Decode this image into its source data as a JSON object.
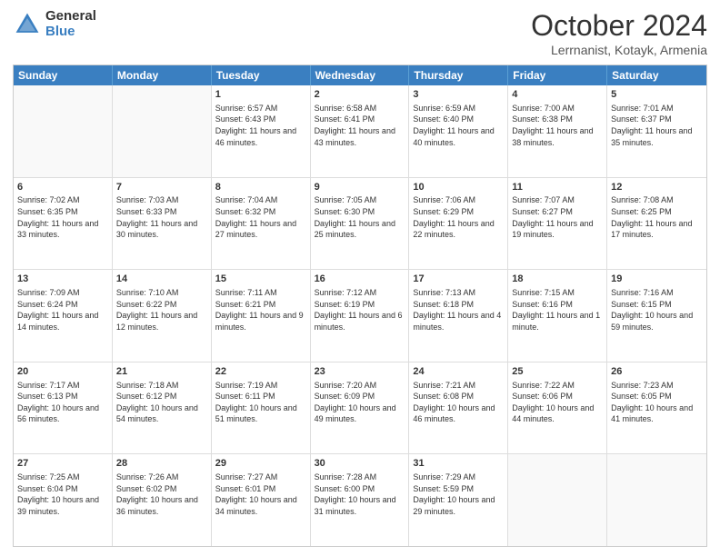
{
  "logo": {
    "general": "General",
    "blue": "Blue"
  },
  "title": "October 2024",
  "location": "Lerrnanist, Kotayk, Armenia",
  "header_days": [
    "Sunday",
    "Monday",
    "Tuesday",
    "Wednesday",
    "Thursday",
    "Friday",
    "Saturday"
  ],
  "weeks": [
    [
      {
        "day": "",
        "sunrise": "",
        "sunset": "",
        "daylight": ""
      },
      {
        "day": "",
        "sunrise": "",
        "sunset": "",
        "daylight": ""
      },
      {
        "day": "1",
        "sunrise": "Sunrise: 6:57 AM",
        "sunset": "Sunset: 6:43 PM",
        "daylight": "Daylight: 11 hours and 46 minutes."
      },
      {
        "day": "2",
        "sunrise": "Sunrise: 6:58 AM",
        "sunset": "Sunset: 6:41 PM",
        "daylight": "Daylight: 11 hours and 43 minutes."
      },
      {
        "day": "3",
        "sunrise": "Sunrise: 6:59 AM",
        "sunset": "Sunset: 6:40 PM",
        "daylight": "Daylight: 11 hours and 40 minutes."
      },
      {
        "day": "4",
        "sunrise": "Sunrise: 7:00 AM",
        "sunset": "Sunset: 6:38 PM",
        "daylight": "Daylight: 11 hours and 38 minutes."
      },
      {
        "day": "5",
        "sunrise": "Sunrise: 7:01 AM",
        "sunset": "Sunset: 6:37 PM",
        "daylight": "Daylight: 11 hours and 35 minutes."
      }
    ],
    [
      {
        "day": "6",
        "sunrise": "Sunrise: 7:02 AM",
        "sunset": "Sunset: 6:35 PM",
        "daylight": "Daylight: 11 hours and 33 minutes."
      },
      {
        "day": "7",
        "sunrise": "Sunrise: 7:03 AM",
        "sunset": "Sunset: 6:33 PM",
        "daylight": "Daylight: 11 hours and 30 minutes."
      },
      {
        "day": "8",
        "sunrise": "Sunrise: 7:04 AM",
        "sunset": "Sunset: 6:32 PM",
        "daylight": "Daylight: 11 hours and 27 minutes."
      },
      {
        "day": "9",
        "sunrise": "Sunrise: 7:05 AM",
        "sunset": "Sunset: 6:30 PM",
        "daylight": "Daylight: 11 hours and 25 minutes."
      },
      {
        "day": "10",
        "sunrise": "Sunrise: 7:06 AM",
        "sunset": "Sunset: 6:29 PM",
        "daylight": "Daylight: 11 hours and 22 minutes."
      },
      {
        "day": "11",
        "sunrise": "Sunrise: 7:07 AM",
        "sunset": "Sunset: 6:27 PM",
        "daylight": "Daylight: 11 hours and 19 minutes."
      },
      {
        "day": "12",
        "sunrise": "Sunrise: 7:08 AM",
        "sunset": "Sunset: 6:25 PM",
        "daylight": "Daylight: 11 hours and 17 minutes."
      }
    ],
    [
      {
        "day": "13",
        "sunrise": "Sunrise: 7:09 AM",
        "sunset": "Sunset: 6:24 PM",
        "daylight": "Daylight: 11 hours and 14 minutes."
      },
      {
        "day": "14",
        "sunrise": "Sunrise: 7:10 AM",
        "sunset": "Sunset: 6:22 PM",
        "daylight": "Daylight: 11 hours and 12 minutes."
      },
      {
        "day": "15",
        "sunrise": "Sunrise: 7:11 AM",
        "sunset": "Sunset: 6:21 PM",
        "daylight": "Daylight: 11 hours and 9 minutes."
      },
      {
        "day": "16",
        "sunrise": "Sunrise: 7:12 AM",
        "sunset": "Sunset: 6:19 PM",
        "daylight": "Daylight: 11 hours and 6 minutes."
      },
      {
        "day": "17",
        "sunrise": "Sunrise: 7:13 AM",
        "sunset": "Sunset: 6:18 PM",
        "daylight": "Daylight: 11 hours and 4 minutes."
      },
      {
        "day": "18",
        "sunrise": "Sunrise: 7:15 AM",
        "sunset": "Sunset: 6:16 PM",
        "daylight": "Daylight: 11 hours and 1 minute."
      },
      {
        "day": "19",
        "sunrise": "Sunrise: 7:16 AM",
        "sunset": "Sunset: 6:15 PM",
        "daylight": "Daylight: 10 hours and 59 minutes."
      }
    ],
    [
      {
        "day": "20",
        "sunrise": "Sunrise: 7:17 AM",
        "sunset": "Sunset: 6:13 PM",
        "daylight": "Daylight: 10 hours and 56 minutes."
      },
      {
        "day": "21",
        "sunrise": "Sunrise: 7:18 AM",
        "sunset": "Sunset: 6:12 PM",
        "daylight": "Daylight: 10 hours and 54 minutes."
      },
      {
        "day": "22",
        "sunrise": "Sunrise: 7:19 AM",
        "sunset": "Sunset: 6:11 PM",
        "daylight": "Daylight: 10 hours and 51 minutes."
      },
      {
        "day": "23",
        "sunrise": "Sunrise: 7:20 AM",
        "sunset": "Sunset: 6:09 PM",
        "daylight": "Daylight: 10 hours and 49 minutes."
      },
      {
        "day": "24",
        "sunrise": "Sunrise: 7:21 AM",
        "sunset": "Sunset: 6:08 PM",
        "daylight": "Daylight: 10 hours and 46 minutes."
      },
      {
        "day": "25",
        "sunrise": "Sunrise: 7:22 AM",
        "sunset": "Sunset: 6:06 PM",
        "daylight": "Daylight: 10 hours and 44 minutes."
      },
      {
        "day": "26",
        "sunrise": "Sunrise: 7:23 AM",
        "sunset": "Sunset: 6:05 PM",
        "daylight": "Daylight: 10 hours and 41 minutes."
      }
    ],
    [
      {
        "day": "27",
        "sunrise": "Sunrise: 7:25 AM",
        "sunset": "Sunset: 6:04 PM",
        "daylight": "Daylight: 10 hours and 39 minutes."
      },
      {
        "day": "28",
        "sunrise": "Sunrise: 7:26 AM",
        "sunset": "Sunset: 6:02 PM",
        "daylight": "Daylight: 10 hours and 36 minutes."
      },
      {
        "day": "29",
        "sunrise": "Sunrise: 7:27 AM",
        "sunset": "Sunset: 6:01 PM",
        "daylight": "Daylight: 10 hours and 34 minutes."
      },
      {
        "day": "30",
        "sunrise": "Sunrise: 7:28 AM",
        "sunset": "Sunset: 6:00 PM",
        "daylight": "Daylight: 10 hours and 31 minutes."
      },
      {
        "day": "31",
        "sunrise": "Sunrise: 7:29 AM",
        "sunset": "Sunset: 5:59 PM",
        "daylight": "Daylight: 10 hours and 29 minutes."
      },
      {
        "day": "",
        "sunrise": "",
        "sunset": "",
        "daylight": ""
      },
      {
        "day": "",
        "sunrise": "",
        "sunset": "",
        "daylight": ""
      }
    ]
  ]
}
